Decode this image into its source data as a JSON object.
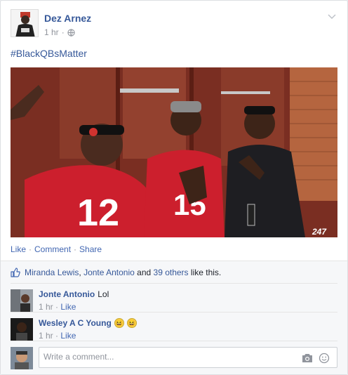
{
  "post": {
    "author": "Dez Arnez",
    "time": "1 hr",
    "separator": "·",
    "text": "#BlackQBsMatter",
    "photo_overlay": "247",
    "jersey_numbers": [
      "12",
      "15"
    ]
  },
  "actions": {
    "like": "Like",
    "comment": "Comment",
    "share": "Share",
    "dot": "·"
  },
  "likes": {
    "names": [
      "Miranda Lewis",
      "Jonte Antonio"
    ],
    "comma": ",",
    "and_text": "and",
    "others": "39 others",
    "suffix": "like this."
  },
  "comments": [
    {
      "name": "Jonte Antonio",
      "text": "Lol",
      "time": "1 hr",
      "like": "Like"
    },
    {
      "name": "Wesley A C Young",
      "text": "",
      "time": "1 hr",
      "like": "Like",
      "emojis": [
        "😆",
        "😆"
      ]
    }
  ],
  "composer": {
    "placeholder": "Write a comment..."
  },
  "colors": {
    "link": "#365899",
    "action": "#4267b2",
    "meta": "#90949c",
    "photo_bg": "#6b2a1f",
    "jersey": "#cc1f2d"
  },
  "icons": [
    "chevron-down-icon",
    "globe-icon",
    "thumbs-up-icon",
    "camera-icon",
    "emoji-smile-icon"
  ]
}
